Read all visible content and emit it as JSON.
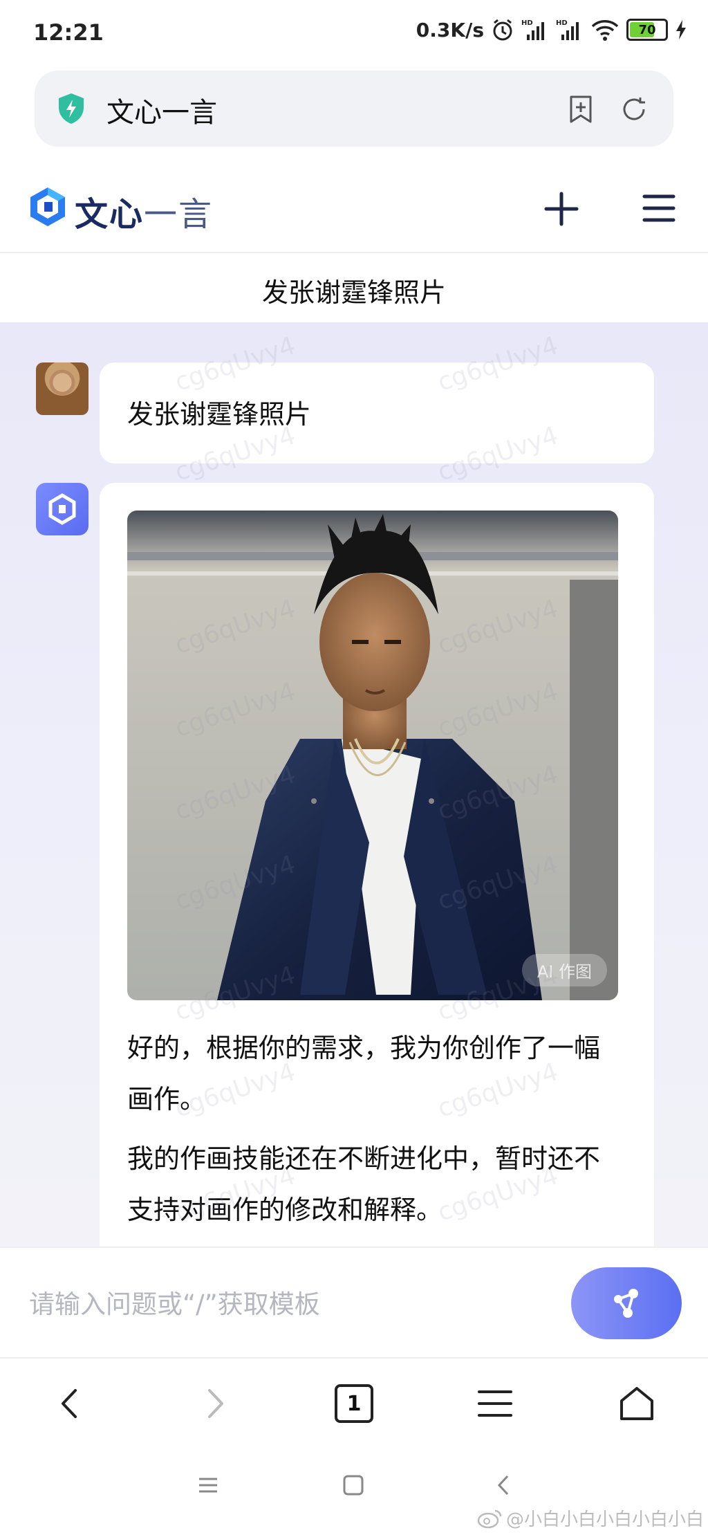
{
  "status": {
    "time": "12:21",
    "net_speed": "0.3K/s",
    "battery_level": 70,
    "battery_text": "70"
  },
  "browser": {
    "url_title": "文心一言",
    "tab_count": "1"
  },
  "app": {
    "logo_text_bold": "文心",
    "logo_text_light": "一言"
  },
  "conversation": {
    "title": "发张谢霆锋照片",
    "user_message": "发张谢霆锋照片",
    "image_badge": "AI 作图",
    "reply_paragraph_1": "好的，根据你的需求，我为你创作了一幅画作。",
    "reply_paragraph_2": "我的作画技能还在不断进化中，暂时还不支持对画作的修改和解释。"
  },
  "input": {
    "placeholder": "请输入问题或“/”获取模板"
  },
  "watermark": "cg6qUvy4",
  "footer_watermark": "@小白小白小白小白小白",
  "colors": {
    "accent": "#5b6ff2",
    "brand_dark": "#1a2a63",
    "shield_green": "#2fbfa0",
    "battery_green": "#6fd233"
  }
}
